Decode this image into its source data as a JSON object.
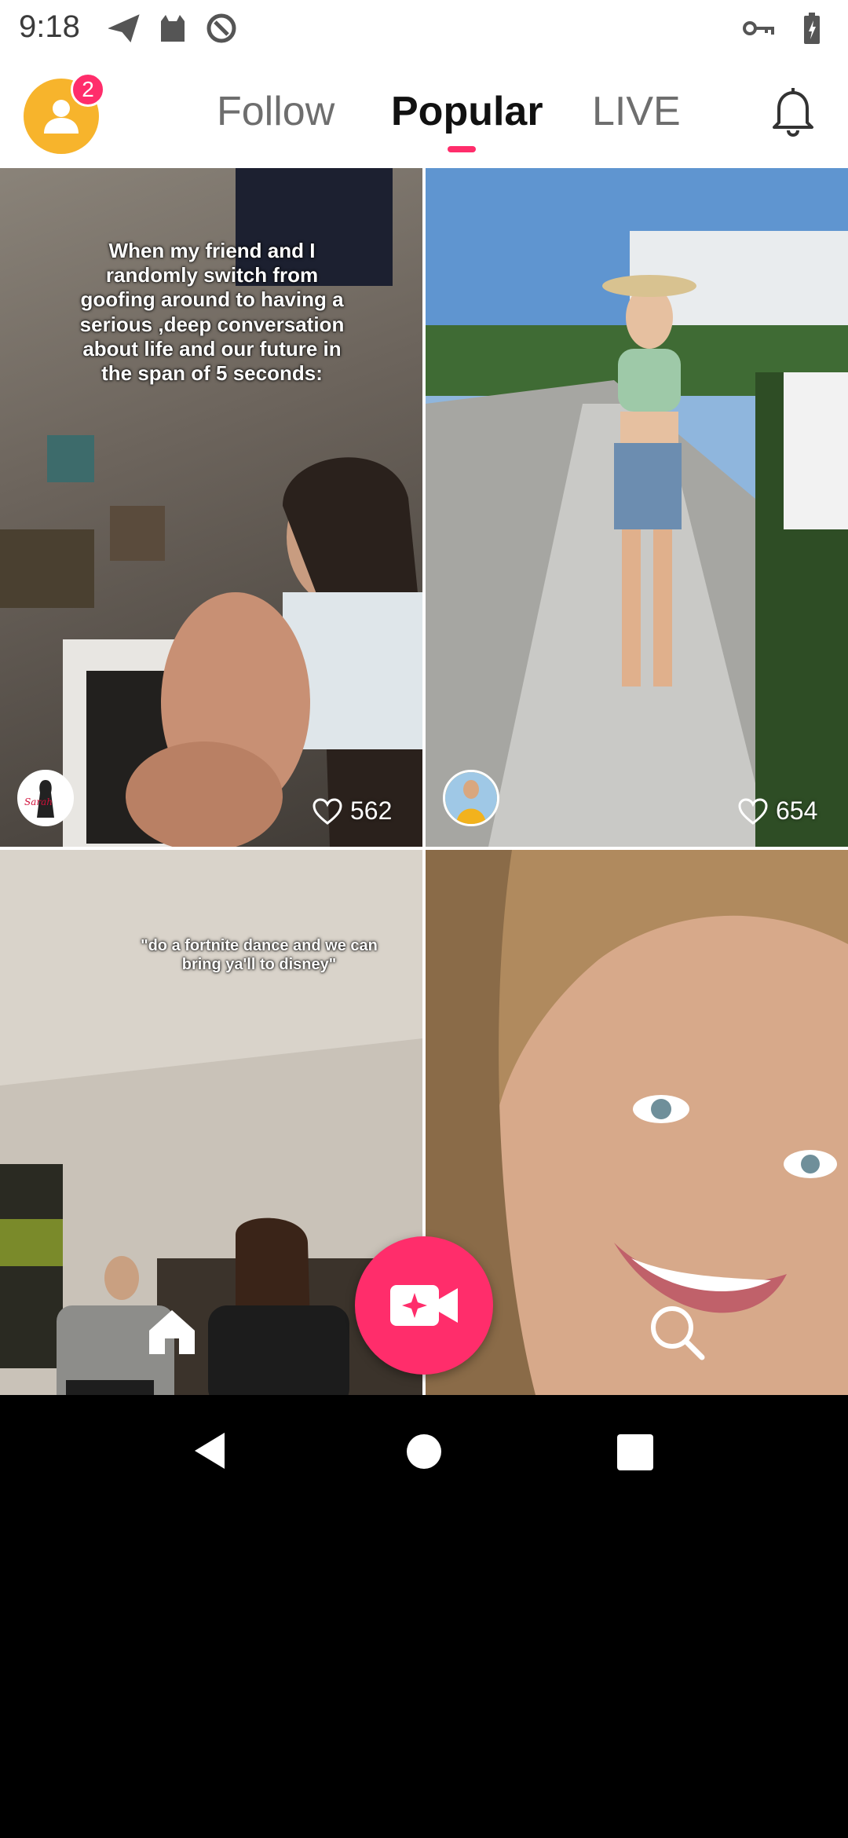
{
  "status_bar": {
    "time": "9:18",
    "icons_left": [
      "send-icon",
      "cat-icon",
      "data-saver-icon"
    ],
    "icons_right": [
      "vpn-key-icon",
      "battery-charging-icon"
    ]
  },
  "header": {
    "avatar_badge": "2",
    "tabs": [
      {
        "label": "Follow",
        "active": false
      },
      {
        "label": "Popular",
        "active": true
      },
      {
        "label": "LIVE",
        "active": false
      }
    ],
    "accent_color": "#ff2d6b"
  },
  "feed": {
    "tiles": [
      {
        "caption": "When my friend and I randomly switch from goofing around to having a serious ,deep conversation about life and our future in the span of 5 seconds:",
        "likes": "562",
        "creator_avatar_text": "Sarah"
      },
      {
        "caption": "",
        "likes": "654",
        "creator_avatar_text": ""
      },
      {
        "caption": "\"do a fortnite dance and we can bring ya'll to disney\"",
        "likes": "",
        "creator_avatar_text": ""
      },
      {
        "caption": "",
        "likes": "",
        "creator_avatar_text": ""
      }
    ]
  },
  "bottom_nav": {
    "items": [
      "home-icon",
      "record-video-icon",
      "search-icon"
    ]
  },
  "android_nav": {
    "items": [
      "back-icon",
      "home-circle-icon",
      "recents-icon"
    ]
  }
}
